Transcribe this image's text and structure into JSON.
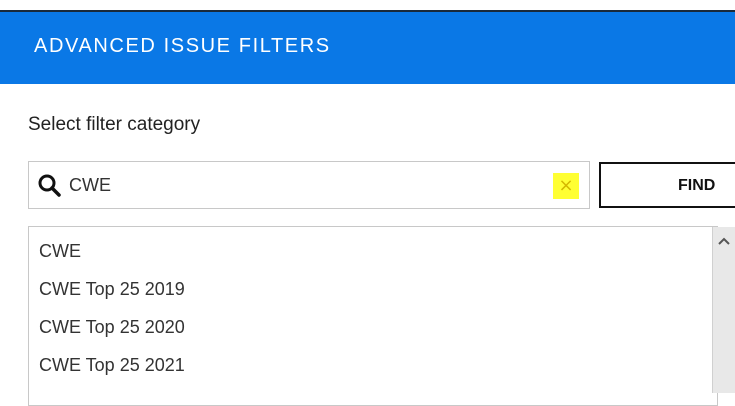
{
  "header": {
    "title": "ADVANCED ISSUE FILTERS"
  },
  "filter": {
    "category_label": "Select filter category",
    "search_value": "CWE",
    "clear_glyph": "×",
    "find_label": "FIND"
  },
  "options": {
    "items": [
      {
        "label": "CWE"
      },
      {
        "label": "CWE Top 25 2019"
      },
      {
        "label": "CWE Top 25 2020"
      },
      {
        "label": "CWE Top 25 2021"
      }
    ]
  },
  "colors": {
    "header_bg": "#0a78e6",
    "clear_highlight": "#ffff33"
  },
  "icons": {
    "search": "search-icon",
    "clear": "close-icon",
    "scroll_up": "chevron-up-icon"
  }
}
